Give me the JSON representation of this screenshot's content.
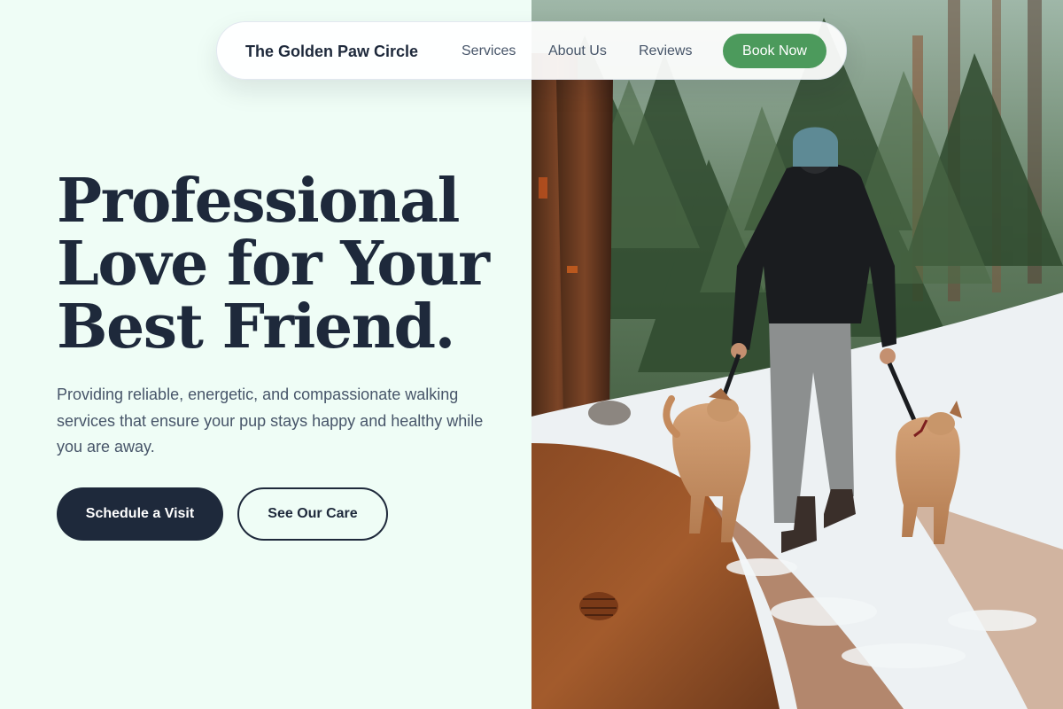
{
  "nav": {
    "brand": "The Golden Paw Circle",
    "links": [
      {
        "label": "Services"
      },
      {
        "label": "About Us"
      },
      {
        "label": "Reviews"
      }
    ],
    "cta_label": "Book Now"
  },
  "hero": {
    "title_lines": [
      "Professional",
      "Love for Your",
      "Best Friend."
    ],
    "subtitle": "Providing reliable, energetic, and compassionate walking services that ensure your pup stays happy and healthy while you are away.",
    "primary_button": "Schedule a Visit",
    "secondary_button": "See Our Care"
  },
  "photo": {
    "subject": "person-walking-two-dogs-on-snowy-forest-trail"
  },
  "colors": {
    "background": "#effdf6",
    "ink": "#1e293b",
    "muted_text": "#475569",
    "accent_green": "#4c9a5c",
    "nav_surface": "#ffffff"
  }
}
